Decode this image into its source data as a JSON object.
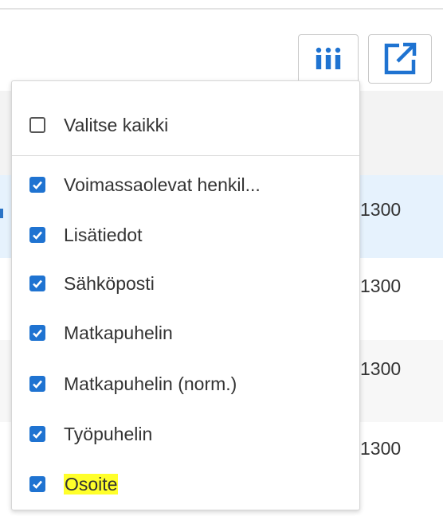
{
  "toolbar": {
    "columns_icon": "column-chooser-icon",
    "export_icon": "external-link-icon"
  },
  "table": {
    "cells": [
      "1300",
      "1300",
      "1300",
      "1300"
    ]
  },
  "dropdown": {
    "select_all": {
      "label": "Valitse kaikki",
      "checked": false
    },
    "items": [
      {
        "label": "Voimassaolevat henkil...",
        "checked": true
      },
      {
        "label": "Lisätiedot",
        "checked": true
      },
      {
        "label": "Sähköposti",
        "checked": true
      },
      {
        "label": "Matkapuhelin",
        "checked": true
      },
      {
        "label": "Matkapuhelin (norm.)",
        "checked": true
      },
      {
        "label": "Työpuhelin",
        "checked": true
      },
      {
        "label": "Osoite",
        "checked": true,
        "highlighted": true
      }
    ]
  },
  "colors": {
    "accent": "#1f73d1",
    "highlight": "#ffff2a",
    "selected_row": "#e6f2fd"
  }
}
